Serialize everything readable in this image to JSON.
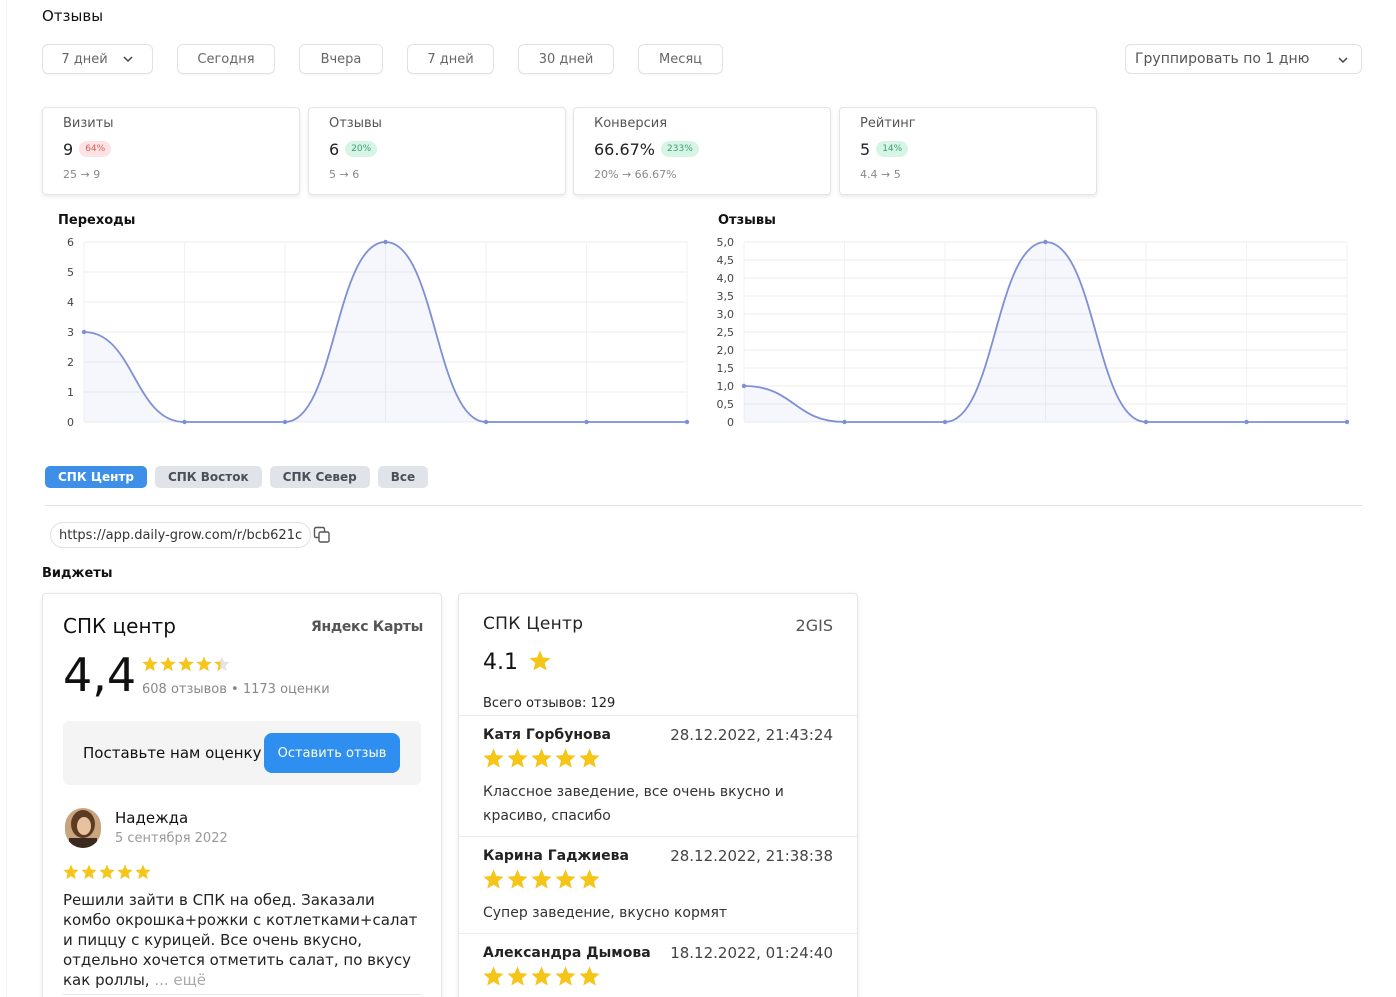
{
  "page": {
    "title": "Отзывы"
  },
  "filters": {
    "period_select": "7 дней",
    "buttons": [
      "Сегодня",
      "Вчера",
      "7 дней",
      "30 дней",
      "Месяц"
    ],
    "group_by": "Группировать по 1 дню"
  },
  "kpis": [
    {
      "title": "Визиты",
      "value": "9",
      "change": "64%",
      "change_type": "negative",
      "from": "25",
      "to": "9"
    },
    {
      "title": "Отзывы",
      "value": "6",
      "change": "20%",
      "change_type": "positive",
      "from": "5",
      "to": "6"
    },
    {
      "title": "Конверсия",
      "value": "66.67%",
      "change": "233%",
      "change_type": "positive",
      "from": "20%",
      "to": "66.67%"
    },
    {
      "title": "Рейтинг",
      "value": "5",
      "change": "14%",
      "change_type": "positive",
      "from": "4.4",
      "to": "5"
    }
  ],
  "chart_data": [
    {
      "type": "area",
      "title": "Переходы",
      "x": [
        1,
        2,
        3,
        4,
        5,
        6,
        7
      ],
      "series": [
        {
          "values": [
            3,
            0,
            0,
            6,
            0,
            0,
            0
          ]
        }
      ],
      "yticks": [
        "0",
        "1",
        "2",
        "3",
        "4",
        "5",
        "6"
      ],
      "ylim": [
        0,
        6
      ],
      "grid": true,
      "color": "#7f8fd6"
    },
    {
      "type": "area",
      "title": "Отзывы",
      "x": [
        1,
        2,
        3,
        4,
        5,
        6,
        7
      ],
      "series": [
        {
          "values": [
            1,
            0,
            0,
            5,
            0,
            0,
            0
          ]
        }
      ],
      "yticks": [
        "0",
        "0,5",
        "1,0",
        "1,5",
        "2,0",
        "2,5",
        "3,0",
        "3,5",
        "4,0",
        "4,5",
        "5,0"
      ],
      "ylim": [
        0,
        5
      ],
      "grid": true,
      "color": "#7f8fd6"
    }
  ],
  "locations": {
    "tabs": [
      "СПК Центр",
      "СПК Восток",
      "СПК Север",
      "Все"
    ],
    "active": "СПК Центр"
  },
  "link": {
    "url": "https://app.daily-grow.com/r/bcb621c"
  },
  "widgets_title": "Виджеты",
  "yandex_widget": {
    "name": "СПК центр",
    "source": "Яндекс Карты",
    "rating": "4,4",
    "rating_value": 4.4,
    "counts": "608 отзывов • 1173 оценки",
    "cta_text": "Поставьте нам оценку",
    "cta_button": "Оставить отзыв",
    "review": {
      "author": "Надежда",
      "date": "5 сентября 2022",
      "stars": 5,
      "text": "Решили зайти в СПК на обед. Заказали комбо окрошка+рожки с котлетками+салат и пиццу с курицей. Все очень вкусно, отдельно хочется отметить салат, по вкусу как роллы,",
      "more": "... ещё"
    }
  },
  "gis_widget": {
    "name": "СПК Центр",
    "source": "2GIS",
    "rating": "4.1",
    "total": "Всего отзывов: 129",
    "reviews": [
      {
        "author": "Катя Горбунова",
        "date": "28.12.2022, 21:43:24",
        "stars": 5,
        "text": "Классное заведение, все очень вкусно и красиво, спасибо"
      },
      {
        "author": "Карина Гаджиева",
        "date": "28.12.2022, 21:38:38",
        "stars": 5,
        "text": "Супер заведение, вкусно кормят"
      },
      {
        "author": "Александра Дымова",
        "date": "18.12.2022, 01:24:40",
        "stars": 5,
        "text": ""
      }
    ]
  },
  "colors": {
    "accent": "#2e8ff0",
    "tab_active": "#3d8fe8",
    "star": "#f5c518",
    "badge_negative": "#d75c5c",
    "badge_positive": "#3d9e6d"
  }
}
